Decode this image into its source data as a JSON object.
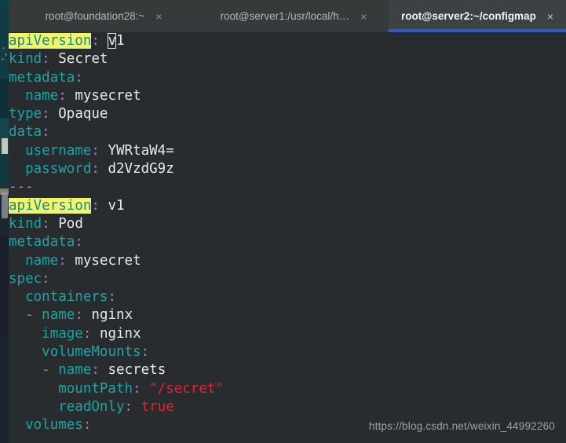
{
  "window": {
    "title": "root@server2:~/configmap"
  },
  "tabs": [
    {
      "label": "root@foundation28:~",
      "close": "×",
      "active": false
    },
    {
      "label": "root@server1:/usr/local/h…",
      "close": "×",
      "active": false
    },
    {
      "label": "root@server2:~/configmap",
      "close": "×",
      "active": true
    }
  ],
  "colors": {
    "background": "#282c2e",
    "tabbar": "#353a3a",
    "active_tab": "#3c4244",
    "active_tab_underline": "#3355cc",
    "key": "#1aa6a6",
    "punctuation": "#b07bbf",
    "value": "#e8eaea",
    "string": "#e8222e",
    "dash": "#cc8a2a",
    "search_highlight_bg": "#f4f46a",
    "search_highlight_fg": "#0f8f8f",
    "watermark": "#9ea3a5"
  },
  "editor": {
    "search_term": "apiVersion",
    "cursor_char": "v",
    "cursor_line": 1,
    "cursor_column": 13,
    "lines": [
      {
        "n": 1,
        "indent": "",
        "key": "apiVersion",
        "highlight": true,
        "sep": ":",
        "value": "v1",
        "value_type": "plain",
        "cursor_on_first_char": true
      },
      {
        "n": 2,
        "indent": "",
        "key": "kind",
        "highlight": false,
        "sep": ":",
        "value": "Secret",
        "value_type": "plain"
      },
      {
        "n": 3,
        "indent": "",
        "key": "metadata",
        "highlight": false,
        "sep": ":",
        "value": "",
        "value_type": "none"
      },
      {
        "n": 4,
        "indent": "  ",
        "key": "name",
        "highlight": false,
        "sep": ":",
        "value": "mysecret",
        "value_type": "plain"
      },
      {
        "n": 5,
        "indent": "",
        "key": "type",
        "highlight": false,
        "sep": ":",
        "value": "Opaque",
        "value_type": "plain"
      },
      {
        "n": 6,
        "indent": "",
        "key": "data",
        "highlight": false,
        "sep": ":",
        "value": "",
        "value_type": "none"
      },
      {
        "n": 7,
        "indent": "  ",
        "key": "username",
        "highlight": false,
        "sep": ":",
        "value": "YWRtaW4=",
        "value_type": "plain"
      },
      {
        "n": 8,
        "indent": "  ",
        "key": "password",
        "highlight": false,
        "sep": ":",
        "value": "d2VzdG9z",
        "value_type": "plain"
      },
      {
        "n": 9,
        "indent": "",
        "key": "",
        "highlight": false,
        "sep": "",
        "value": "",
        "value_type": "docsep",
        "raw": "---"
      },
      {
        "n": 10,
        "indent": "",
        "key": "apiVersion",
        "highlight": true,
        "sep": ":",
        "value": "v1",
        "value_type": "plain"
      },
      {
        "n": 11,
        "indent": "",
        "key": "kind",
        "highlight": false,
        "sep": ":",
        "value": "Pod",
        "value_type": "plain"
      },
      {
        "n": 12,
        "indent": "",
        "key": "metadata",
        "highlight": false,
        "sep": ":",
        "value": "",
        "value_type": "none"
      },
      {
        "n": 13,
        "indent": "  ",
        "key": "name",
        "highlight": false,
        "sep": ":",
        "value": "mysecret",
        "value_type": "plain"
      },
      {
        "n": 14,
        "indent": "",
        "key": "spec",
        "highlight": false,
        "sep": ":",
        "value": "",
        "value_type": "none"
      },
      {
        "n": 15,
        "indent": "  ",
        "key": "containers",
        "highlight": false,
        "sep": ":",
        "value": "",
        "value_type": "none"
      },
      {
        "n": 16,
        "indent": "  ",
        "key": "name",
        "highlight": false,
        "sep": ":",
        "value": "nginx",
        "value_type": "plain",
        "bullet": "-"
      },
      {
        "n": 17,
        "indent": "    ",
        "key": "image",
        "highlight": false,
        "sep": ":",
        "value": "nginx",
        "value_type": "plain"
      },
      {
        "n": 18,
        "indent": "    ",
        "key": "volumeMounts",
        "highlight": false,
        "sep": ":",
        "value": "",
        "value_type": "none"
      },
      {
        "n": 19,
        "indent": "    ",
        "key": "name",
        "highlight": false,
        "sep": ":",
        "value": "secrets",
        "value_type": "plain",
        "bullet": "-"
      },
      {
        "n": 20,
        "indent": "      ",
        "key": "mountPath",
        "highlight": false,
        "sep": ":",
        "value": "\"/secret\"",
        "value_type": "string"
      },
      {
        "n": 21,
        "indent": "      ",
        "key": "readOnly",
        "highlight": false,
        "sep": ":",
        "value": "true",
        "value_type": "string"
      },
      {
        "n": 22,
        "indent": "  ",
        "key": "volumes",
        "highlight": false,
        "sep": ":",
        "value": "",
        "value_type": "none"
      }
    ]
  },
  "watermark": {
    "text": "https://blog.csdn.net/weixin_44992260"
  }
}
